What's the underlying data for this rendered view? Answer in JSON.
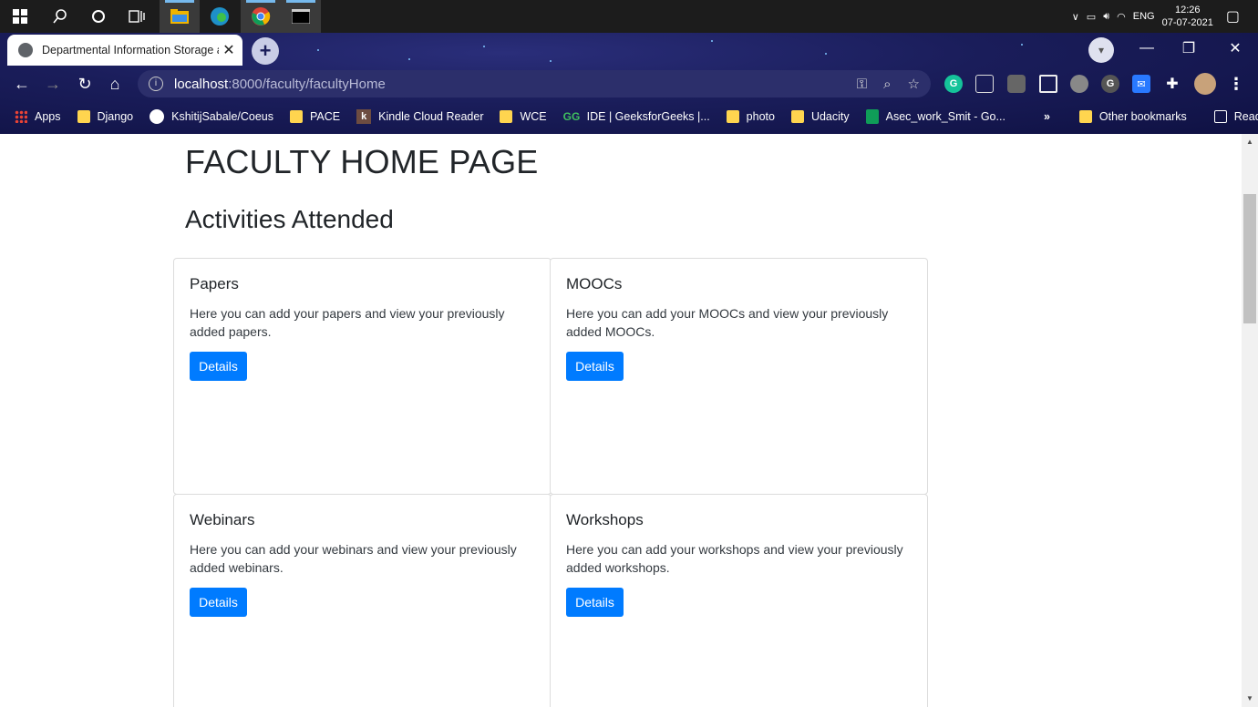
{
  "taskbar": {
    "icons": [
      "windows-icon",
      "search-icon",
      "cortana-icon",
      "task-view-icon",
      "file-explorer-icon",
      "edge-icon",
      "chrome-icon",
      "terminal-icon"
    ],
    "tray": {
      "language": "ENG",
      "time": "12:26",
      "date": "07-07-2021"
    }
  },
  "browser": {
    "tab_title": "Departmental Information Storage a",
    "tab_close": "✕",
    "new_tab": "+",
    "url_host": "localhost",
    "url_path": ":8000/faculty/facultyHome",
    "window_controls": {
      "minimize": "—",
      "restore": "❐",
      "close": "✕"
    },
    "bookmarks": [
      {
        "label": "Apps",
        "icon": "apps-icon"
      },
      {
        "label": "Django",
        "icon": "folder-icon"
      },
      {
        "label": "KshitijSabale/Coeus",
        "icon": "github-icon"
      },
      {
        "label": "PACE",
        "icon": "folder-icon"
      },
      {
        "label": "Kindle Cloud Reader",
        "icon": "kindle-icon"
      },
      {
        "label": "WCE",
        "icon": "folder-icon"
      },
      {
        "label": "IDE | GeeksforGeeks |...",
        "icon": "gfg-icon"
      },
      {
        "label": "photo",
        "icon": "folder-icon"
      },
      {
        "label": "Udacity",
        "icon": "folder-icon"
      },
      {
        "label": "Asec_work_Smit - Go...",
        "icon": "sheets-icon"
      }
    ],
    "more_bookmarks": "»",
    "other_bookmarks": "Other bookmarks",
    "reading_list": "Reading list"
  },
  "page": {
    "title": "FACULTY HOME PAGE",
    "subtitle": "Activities Attended",
    "cards": [
      {
        "title": "Papers",
        "description": "Here you can add your papers and view your previously added papers.",
        "button": "Details"
      },
      {
        "title": "MOOCs",
        "description": "Here you can add your MOOCs and view your previously added MOOCs.",
        "button": "Details"
      },
      {
        "title": "Webinars",
        "description": "Here you can add your webinars and view your previously added webinars.",
        "button": "Details"
      },
      {
        "title": "Workshops",
        "description": "Here you can add your workshops and view your previously added workshops.",
        "button": "Details"
      }
    ]
  },
  "colors": {
    "primary_button": "#007bff",
    "chrome_bg": "#1a1d5a",
    "taskbar_bg": "#1c1c1c"
  }
}
